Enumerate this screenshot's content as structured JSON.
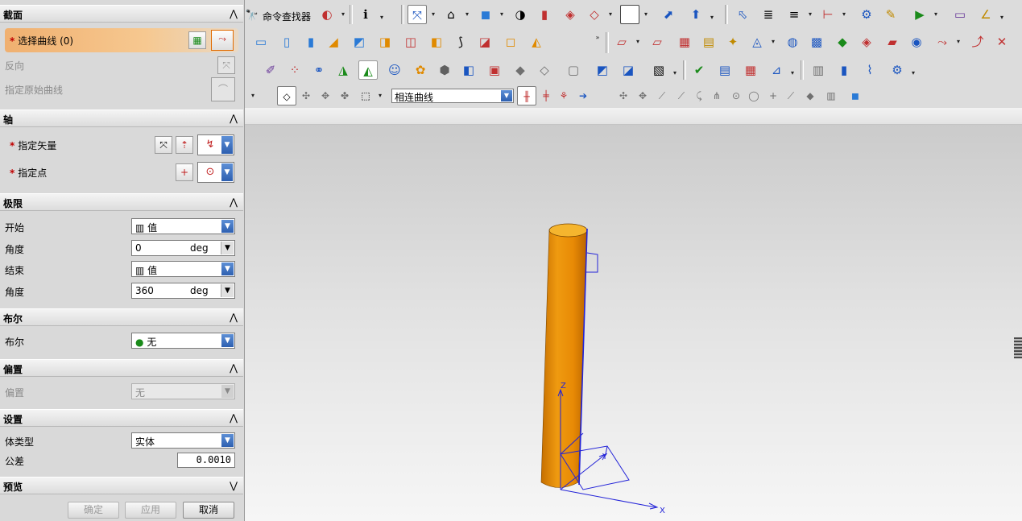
{
  "dialog": {
    "sections": {
      "section": {
        "title": "截面",
        "select_curve": "选择曲线 (0)",
        "reverse": "反向",
        "specify_origin_curve": "指定原始曲线"
      },
      "axis": {
        "title": "轴",
        "specify_vector": "指定矢量",
        "specify_point": "指定点"
      },
      "limits": {
        "title": "极限",
        "start_label": "开始",
        "start_value": "值",
        "start_angle_label": "角度",
        "start_angle_value": "0",
        "start_angle_unit": "deg",
        "end_label": "结束",
        "end_value": "值",
        "end_angle_label": "角度",
        "end_angle_value": "360",
        "end_angle_unit": "deg"
      },
      "boolean": {
        "title": "布尔",
        "label": "布尔",
        "value": "无"
      },
      "offset": {
        "title": "偏置",
        "label": "偏置",
        "value": "无"
      },
      "settings": {
        "title": "设置",
        "body_type_label": "体类型",
        "body_type_value": "实体",
        "tolerance_label": "公差",
        "tolerance_value": "0.0010"
      },
      "preview": {
        "title": "预览"
      }
    },
    "required_mark": "*",
    "buttons": {
      "ok": "确定",
      "apply": "应用",
      "cancel": "取消"
    }
  },
  "toolbar": {
    "command_finder": "命令查找器",
    "selection_filter": "相连曲线"
  },
  "viewport": {
    "axes": {
      "x": "X",
      "y": "Y",
      "z": "Z"
    },
    "colors": {
      "body": "#e8900a",
      "body_top": "#f5b52e",
      "csys": "#2323d8"
    }
  }
}
